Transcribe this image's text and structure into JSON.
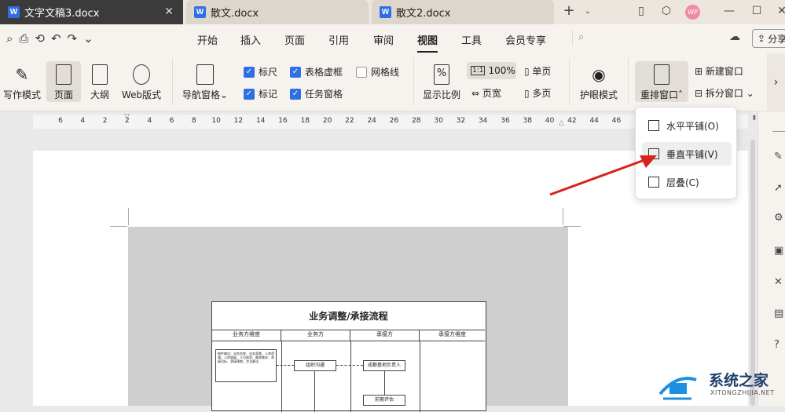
{
  "tabs": [
    {
      "label": "文字文稿3.docx",
      "active": true
    },
    {
      "label": "散文.docx",
      "active": false
    },
    {
      "label": "散文2.docx",
      "active": false
    }
  ],
  "user_avatar": "WP",
  "share_label": "分享",
  "menu": [
    "开始",
    "插入",
    "页面",
    "引用",
    "审阅",
    "视图",
    "工具",
    "会员专享"
  ],
  "active_menu": "视图",
  "ribbon": {
    "write_mode": "写作模式",
    "page": "页面",
    "outline": "大纲",
    "web_layout": "Web版式",
    "nav_pane": "导航窗格",
    "ruler": "标尺",
    "table_grid": "表格虚框",
    "gridlines": "网格线",
    "marks": "标记",
    "task_pane": "任务窗格",
    "zoom": "显示比例",
    "zoom_100": "100%",
    "single_page": "单页",
    "page_width": "页宽",
    "multi_page": "多页",
    "eye_mode": "护眼模式",
    "rearrange": "重排窗口",
    "new_window": "新建窗口",
    "split_window": "拆分窗口"
  },
  "checkboxes": {
    "ruler": true,
    "table_grid": true,
    "gridlines": false,
    "marks": true,
    "task_pane": true
  },
  "ruler_ticks": [
    "6",
    "4",
    "2",
    "2",
    "4",
    "6",
    "8",
    "10",
    "12",
    "14",
    "16",
    "18",
    "20",
    "22",
    "24",
    "26",
    "28",
    "30",
    "32",
    "34",
    "36",
    "38",
    "40",
    "42",
    "44",
    "46"
  ],
  "dropdown": [
    {
      "label": "水平平铺(O)",
      "highlight": false
    },
    {
      "label": "垂直平铺(V)",
      "highlight": true
    },
    {
      "label": "层叠(C)",
      "highlight": false
    }
  ],
  "flowchart": {
    "title": "业务调整/承接流程",
    "columns": [
      "业务方维度",
      "业务方",
      "承接方",
      "承接方维度"
    ],
    "note": "邮件输出：业务名称、业务背景、人库逻辑、人库量级、人均效率、剩除需求、承接目标、承接预期、涉及算法",
    "box1": "组织沟通",
    "box2": "成都基地负责人",
    "box3": "前期评估"
  },
  "watermark": {
    "brand": "系统之家",
    "url": "XITONGZHIJIA.NET"
  }
}
